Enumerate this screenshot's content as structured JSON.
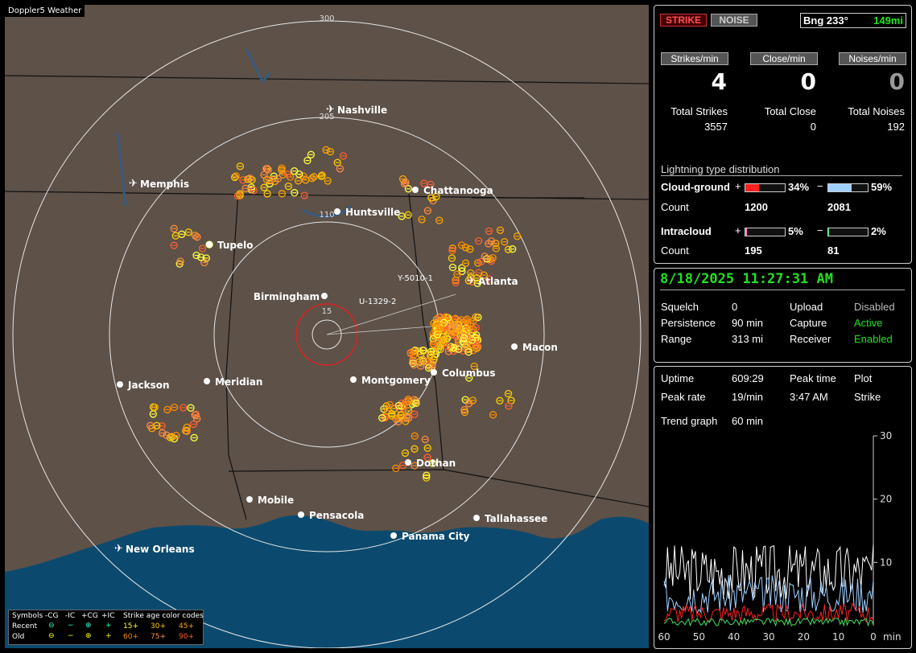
{
  "app": {
    "title": "Doppler5 Weather"
  },
  "map": {
    "range_rings": [
      "300",
      "205",
      "110",
      "15"
    ],
    "storms": [
      "Y-5010-1",
      "U-1329-2"
    ],
    "cities": [
      {
        "name": "Nashville",
        "airport": true
      },
      {
        "name": "Memphis",
        "airport": true
      },
      {
        "name": "Chattanooga",
        "airport": false
      },
      {
        "name": "Huntsville",
        "airport": false
      },
      {
        "name": "Tupelo",
        "airport": false
      },
      {
        "name": "Atlanta",
        "airport": true
      },
      {
        "name": "Birmingham",
        "airport": false
      },
      {
        "name": "Macon",
        "airport": false
      },
      {
        "name": "Columbus",
        "airport": false
      },
      {
        "name": "Montgomery",
        "airport": false
      },
      {
        "name": "Meridian",
        "airport": false
      },
      {
        "name": "Jackson",
        "airport": false
      },
      {
        "name": "Dothan",
        "airport": false
      },
      {
        "name": "Mobile",
        "airport": false
      },
      {
        "name": "Pensacola",
        "airport": false
      },
      {
        "name": "Tallahassee",
        "airport": false
      },
      {
        "name": "Panama City",
        "airport": false
      },
      {
        "name": "New Orleans",
        "airport": true
      }
    ],
    "legend": {
      "headers": [
        "Symbols",
        "-CG",
        "-IC",
        "+CG",
        "+IC",
        "Strike age color codes"
      ],
      "rows": [
        {
          "label": "Recent",
          "ages": [
            "15+",
            "30+",
            "45+"
          ]
        },
        {
          "label": "Old",
          "ages": [
            "60+",
            "75+",
            "90+"
          ]
        }
      ],
      "age_colors": [
        "#ffff40",
        "#ffa500",
        "#ff8c00",
        "#ffcc00",
        "#ff8c3c",
        "#ff6030"
      ]
    }
  },
  "status": {
    "strike_btn": "STRIKE",
    "noise_btn": "NOISE",
    "bearing": "Bng 233°",
    "distance": "149mi",
    "rates": [
      {
        "label": "Strikes/min",
        "value": "4"
      },
      {
        "label": "Close/min",
        "value": "0"
      },
      {
        "label": "Noises/min",
        "value": "0"
      }
    ],
    "totals": [
      {
        "label": "Total Strikes",
        "value": "3557"
      },
      {
        "label": "Total Close",
        "value": "0"
      },
      {
        "label": "Total Noises",
        "value": "192"
      }
    ],
    "dist_title": "Lightning type distribution",
    "cloud_ground": {
      "label": "Cloud-ground",
      "pos_pct": "34%",
      "neg_pct": "59%",
      "pos_fraction": 0.34,
      "neg_fraction": 0.59,
      "count_label": "Count",
      "pos_count": "1200",
      "neg_count": "2081"
    },
    "intracloud": {
      "label": "Intracloud",
      "pos_pct": "5%",
      "neg_pct": "2%",
      "pos_fraction": 0.05,
      "neg_fraction": 0.02,
      "count_label": "Count",
      "pos_count": "195",
      "neg_count": "81"
    },
    "plus": "+",
    "minus": "−"
  },
  "settings": {
    "datetime": "8/18/2025 11:27:31 AM",
    "rows": [
      {
        "k": "Squelch",
        "v": "0",
        "k2": "Upload",
        "v2": "Disabled"
      },
      {
        "k": "Persistence",
        "v": "90 min",
        "k2": "Capture",
        "v2": "Active"
      },
      {
        "k": "Range",
        "v": "313 mi",
        "k2": "Receiver",
        "v2": "Enabled"
      }
    ]
  },
  "trend": {
    "uptime_label": "Uptime",
    "uptime": "609:29",
    "peak_time_label": "Peak time",
    "peak_time": "3:47 AM",
    "plot_label": "Plot",
    "plot": "Strike",
    "peak_rate_label": "Peak rate",
    "peak_rate": "19/min",
    "graph_label": "Trend graph",
    "graph_span": "60 min",
    "y_ticks": [
      "30",
      "20",
      "10"
    ],
    "x_ticks": [
      "60",
      "50",
      "40",
      "30",
      "20",
      "10",
      "0"
    ],
    "x_unit": "min"
  },
  "colors": {
    "red": "#ff2020",
    "blue": "#9fd0ff",
    "pink": "#ff80c0",
    "green": "#40e060",
    "accent_green": "#22e022"
  }
}
